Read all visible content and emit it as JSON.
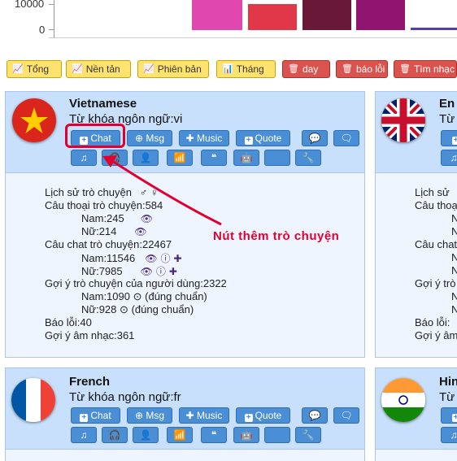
{
  "chart": {
    "y_ticks": [
      "10000",
      "0"
    ],
    "bar_colors": [
      "#e048b0",
      "#e03848",
      "#6a1838",
      "#901470"
    ]
  },
  "toolbar": {
    "buttons": [
      {
        "label": "Tổng",
        "icon": "line-chart-icon",
        "style": "yellow"
      },
      {
        "label": "Nền tản",
        "icon": "line-chart-icon",
        "style": "yellow"
      },
      {
        "label": "Phiên bản",
        "icon": "line-chart-icon",
        "style": "yellow"
      },
      {
        "label": "Tháng",
        "icon": "bar-chart-icon",
        "style": "yellow"
      },
      {
        "label": "day",
        "icon": "trash-icon",
        "style": "red"
      },
      {
        "label": "báo lỗi",
        "icon": "trash-icon",
        "style": "red"
      },
      {
        "label": "Tìm nhạc",
        "icon": "trash-icon",
        "style": "red"
      }
    ]
  },
  "cards": {
    "vietnamese": {
      "name": "Vietnamese",
      "keyword": "Từ khóa ngôn ngữ:vi",
      "buttons": {
        "chat": "Chat",
        "msg": "Msg",
        "music": "Music",
        "quote": "Quote"
      },
      "stats": {
        "history": "Lịch sử trò chuyện",
        "history_icons": "♂ ♀",
        "dialogs": "Câu thoại trò chuyện:584",
        "dialogs_male": "Nam:245",
        "dialogs_female": "Nữ:214",
        "chats": "Câu chat trò chuyện:22467",
        "chats_male": "Nam:11546",
        "chats_female": "Nữ:7985",
        "suggest": "Gợi ý trò chuyện của người dùng:2322",
        "suggest_male": "Nam:1090",
        "suggest_male_note": "(đúng chuẩn)",
        "suggest_female": "Nữ:928",
        "suggest_female_note": "(đúng chuẩn)",
        "bugs": "Báo lỗi:40",
        "music": "Gợi ý âm nhạc:361"
      }
    },
    "english": {
      "name": "En",
      "keyword": "Từ",
      "stats": [
        "Lịch sử",
        "Câu thoạ",
        "N",
        "N",
        "Câu chat",
        "N",
        "N",
        "Gợi ý trò",
        "N",
        "N",
        "Báo lỗi:",
        "Gợi ý âm"
      ]
    },
    "french": {
      "name": "French",
      "keyword": "Từ khóa ngôn ngữ:fr",
      "buttons": {
        "chat": "Chat",
        "msg": "Msg",
        "music": "Music",
        "quote": "Quote"
      }
    },
    "hindi": {
      "name": "Hin",
      "keyword": "Từ"
    }
  },
  "annotation": {
    "text": "Nút thêm trò chuyện",
    "color": "#e00030"
  }
}
